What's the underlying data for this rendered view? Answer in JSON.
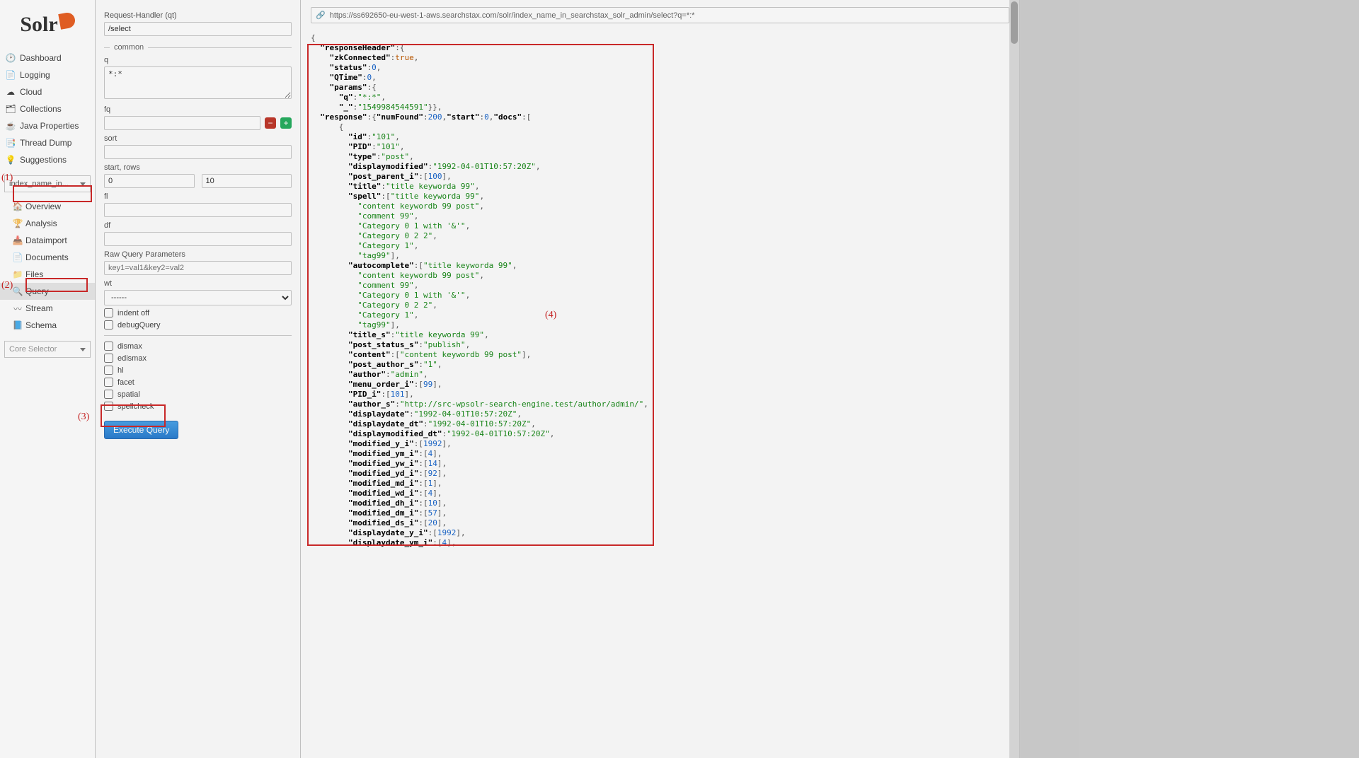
{
  "logo_text": "Solr",
  "nav": {
    "dashboard": "Dashboard",
    "logging": "Logging",
    "cloud": "Cloud",
    "collections": "Collections",
    "java_properties": "Java Properties",
    "thread_dump": "Thread Dump",
    "suggestions": "Suggestions"
  },
  "index_dropdown": "index_name_in...",
  "core_selector_placeholder": "Core Selector",
  "subnav": {
    "overview": "Overview",
    "analysis": "Analysis",
    "dataimport": "Dataimport",
    "documents": "Documents",
    "files": "Files",
    "query": "Query",
    "stream": "Stream",
    "schema": "Schema"
  },
  "form": {
    "request_handler_label": "Request-Handler (qt)",
    "request_handler_value": "/select",
    "common_legend": "common",
    "q_label": "q",
    "q_value": "*:*",
    "fq_label": "fq",
    "sort_label": "sort",
    "start_rows_label": "start, rows",
    "start_value": "0",
    "rows_value": "10",
    "fl_label": "fl",
    "df_label": "df",
    "raw_params_label": "Raw Query Parameters",
    "raw_params_placeholder": "key1=val1&key2=val2",
    "wt_label": "wt",
    "wt_value": "------",
    "chk_indent_off": "indent off",
    "chk_debugQuery": "debugQuery",
    "chk_dismax": "dismax",
    "chk_edismax": "edismax",
    "chk_hl": "hl",
    "chk_facet": "facet",
    "chk_spatial": "spatial",
    "chk_spellcheck": "spellcheck",
    "execute": "Execute Query"
  },
  "result_url": "https://ss692650-eu-west-1-aws.searchstax.com/solr/index_name_in_searchstax_solr_admin/select?q=*:*",
  "callouts": {
    "c1": "(1)",
    "c2": "(2)",
    "c3": "(3)",
    "c4": "(4)"
  },
  "json": {
    "responseHeader": {
      "zkConnected": true,
      "status": 0,
      "QTime": 0,
      "params": {
        "q": "*:*",
        "_": "1549984544591"
      }
    },
    "response": {
      "numFound": 200,
      "start": 0,
      "doc0": {
        "id": "101",
        "PID": "101",
        "type": "post",
        "displaymodified": "1992-04-01T10:57:20Z",
        "post_parent_i": [
          100
        ],
        "title": "title keyworda 99",
        "spell": [
          "title keyworda 99",
          "content keywordb 99 post",
          "comment 99",
          "Category 0 1 with '&amp;'",
          "Category 0 2 2",
          "Category 1",
          "tag99"
        ],
        "autocomplete": [
          "title keyworda 99",
          "content keywordb 99 post",
          "comment 99",
          "Category 0 1 with '&amp;'",
          "Category 0 2 2",
          "Category 1",
          "tag99"
        ],
        "title_s": "title keyworda 99",
        "post_status_s": "publish",
        "content": [
          "content keywordb 99 post"
        ],
        "post_author_s": "1",
        "author": "admin",
        "menu_order_i": [
          99
        ],
        "PID_i": [
          101
        ],
        "author_s": "http://src-wpsolr-search-engine.test/author/admin/",
        "displaydate": "1992-04-01T10:57:20Z",
        "displaydate_dt": "1992-04-01T10:57:20Z",
        "displaymodified_dt": "1992-04-01T10:57:20Z",
        "modified_y_i": [
          1992
        ],
        "modified_ym_i": [
          4
        ],
        "modified_yw_i": [
          14
        ],
        "modified_yd_i": [
          92
        ],
        "modified_md_i": [
          1
        ],
        "modified_wd_i": [
          4
        ],
        "modified_dh_i": [
          10
        ],
        "modified_dm_i": [
          57
        ],
        "modified_ds_i": [
          20
        ],
        "displaydate_y_i": [
          1992
        ],
        "displaydate_ym_i": [
          4
        ]
      }
    }
  }
}
